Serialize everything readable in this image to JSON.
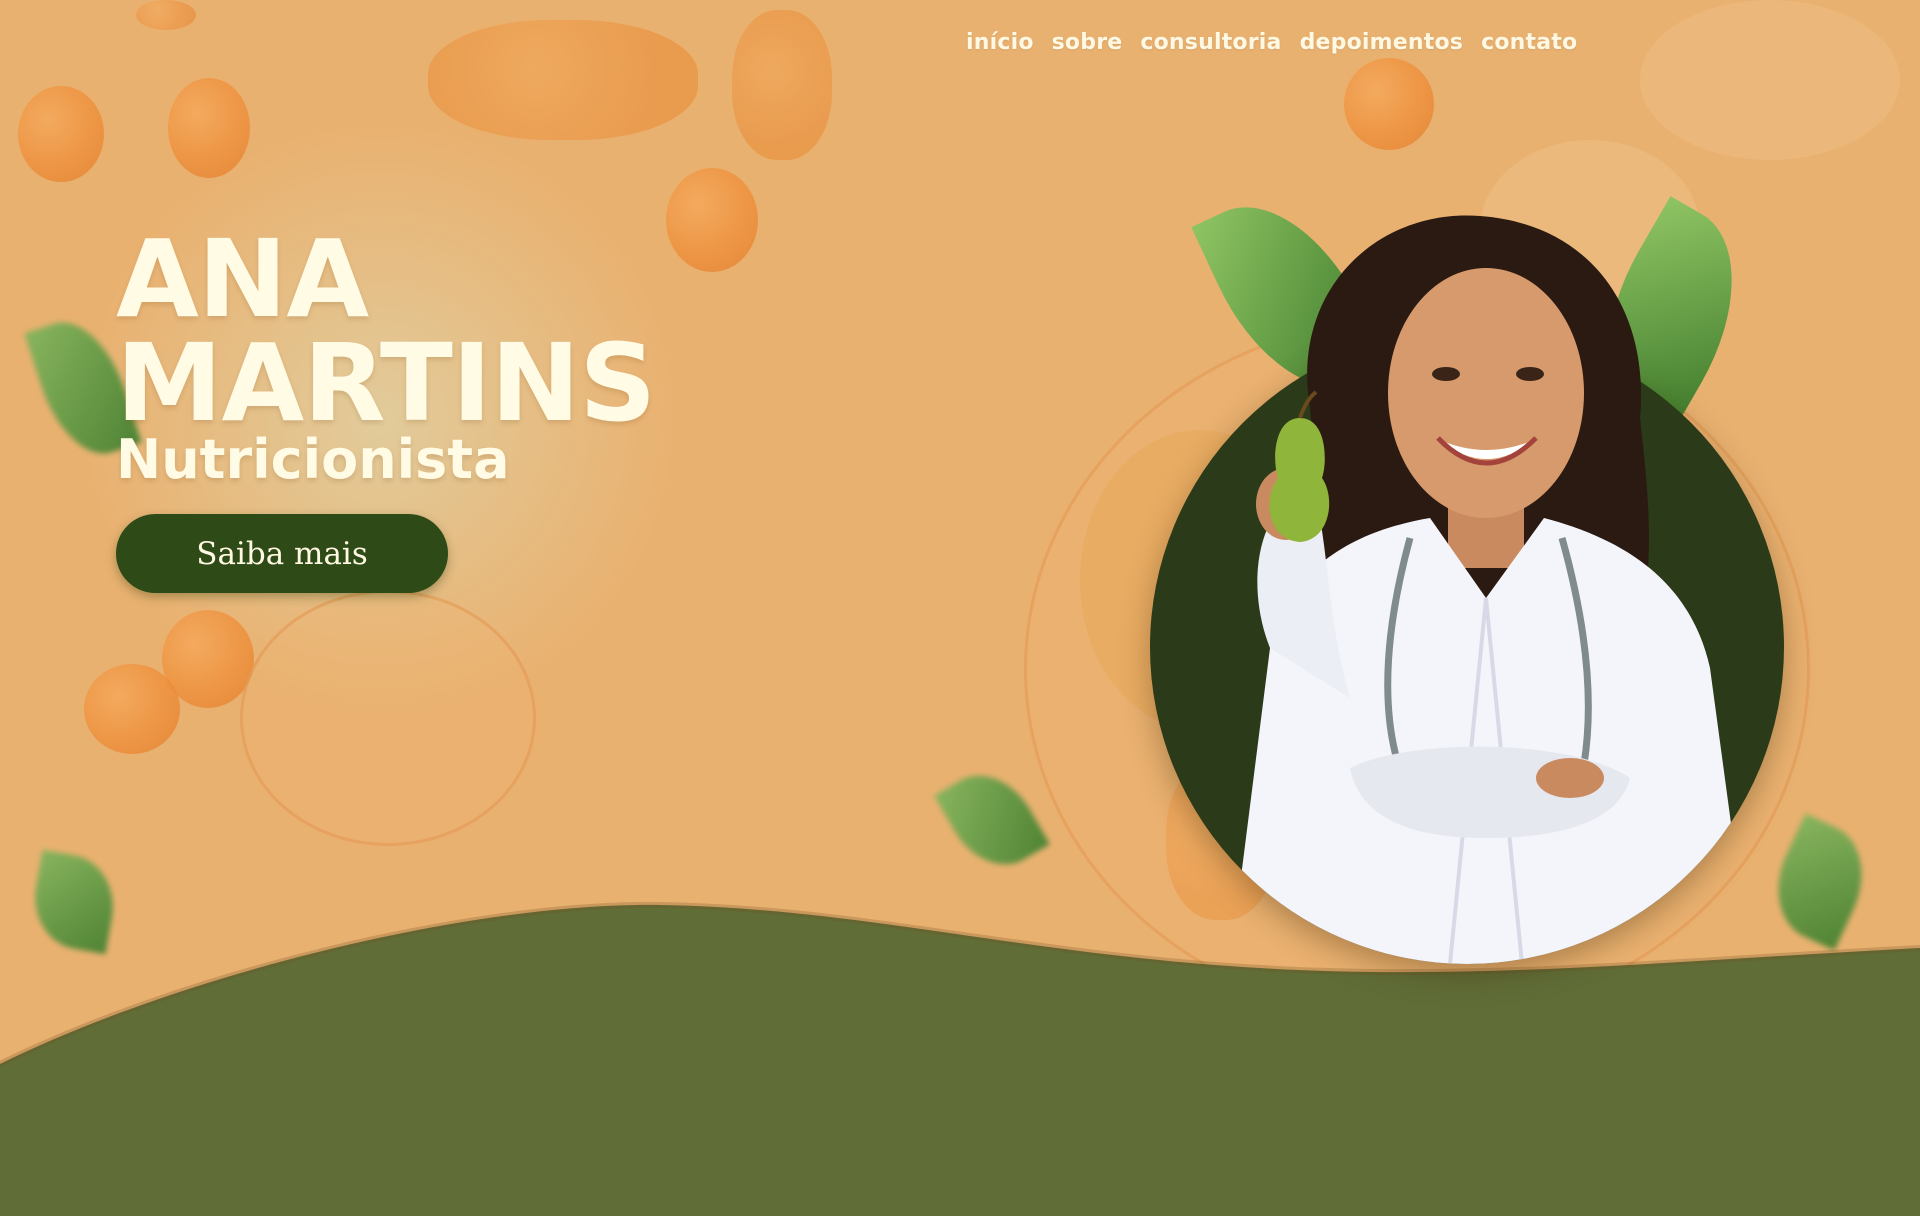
{
  "nav": {
    "items": [
      {
        "label": "início"
      },
      {
        "label": "sobre"
      },
      {
        "label": "consultoria"
      },
      {
        "label": "depoimentos"
      },
      {
        "label": "contato"
      }
    ]
  },
  "hero": {
    "title_line1": "ANA",
    "title_line2": "MARTINS",
    "subtitle": "Nutricionista",
    "cta_label": "Saiba mais"
  },
  "colors": {
    "background_orange": "#e9b170",
    "wave_green": "#606d37",
    "button_green": "#2e4a17",
    "portrait_circle": "#2b3a18",
    "text_cream": "#fffbe4"
  },
  "icons": {
    "hero_image": "nutritionist-portrait",
    "decor": "leaf-icon"
  }
}
